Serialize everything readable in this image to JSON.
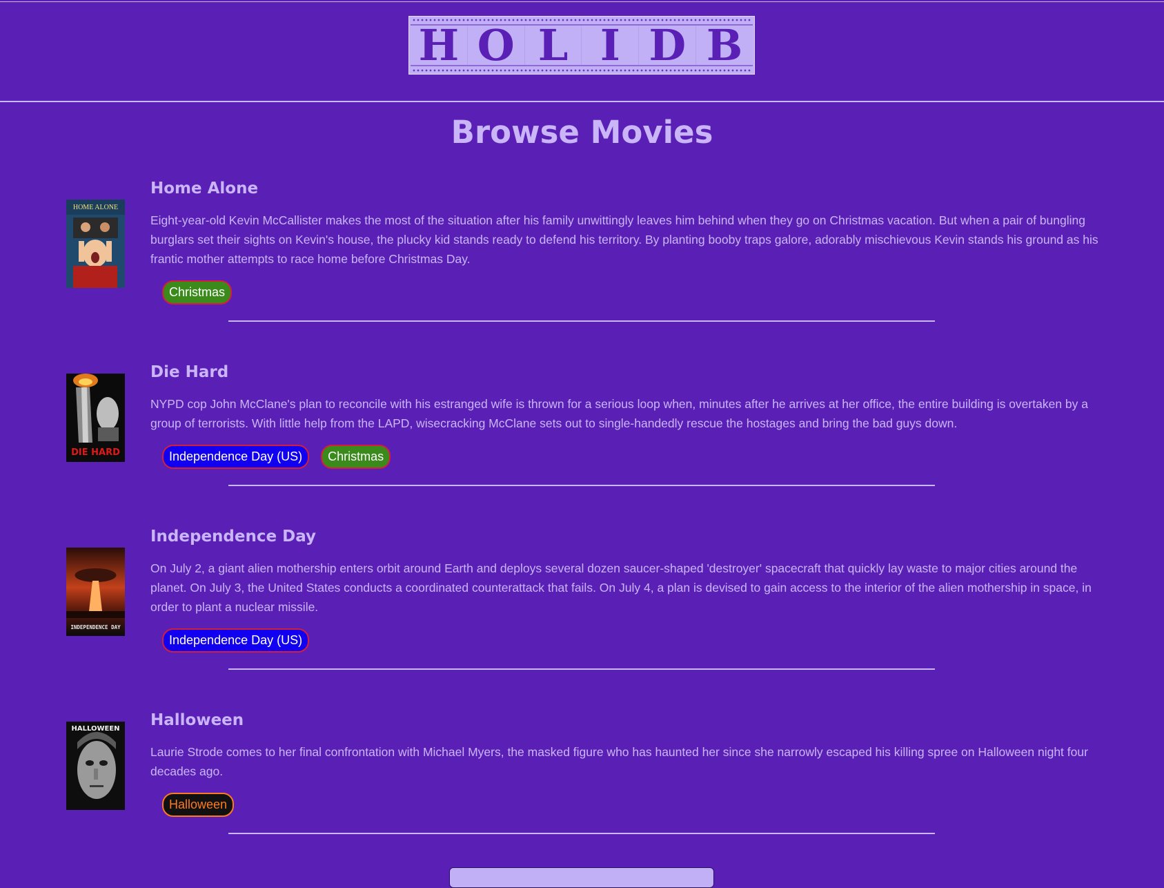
{
  "header": {
    "logo_letters": [
      "H",
      "O",
      "L",
      "I",
      "D",
      "B"
    ]
  },
  "page": {
    "title": "Browse Movies"
  },
  "movies": [
    {
      "title": "Home Alone",
      "description": "Eight-year-old Kevin McCallister makes the most of the situation after his family unwittingly leaves him behind when they go on Christmas vacation. But when a pair of bungling burglars set their sights on Kevin's house, the plucky kid stands ready to defend his territory. By planting booby traps galore, adorably mischievous Kevin stands his ground as his frantic mother attempts to race home before Christmas Day.",
      "poster_text": "HOME ALONE",
      "tags": [
        "Christmas"
      ]
    },
    {
      "title": "Die Hard",
      "description": "NYPD cop John McClane's plan to reconcile with his estranged wife is thrown for a serious loop when, minutes after he arrives at her office, the entire building is overtaken by a group of terrorists. With little help from the LAPD, wisecracking McClane sets out to single-handedly rescue the hostages and bring the bad guys down.",
      "poster_text": "DIE HARD",
      "tags": [
        "Independence Day (US)",
        "Christmas"
      ]
    },
    {
      "title": "Independence Day",
      "description": "On July 2, a giant alien mothership enters orbit around Earth and deploys several dozen saucer-shaped 'destroyer' spacecraft that quickly lay waste to major cities around the planet. On July 3, the United States conducts a coordinated counterattack that fails. On July 4, a plan is devised to gain access to the interior of the alien mothership in space, in order to plant a nuclear missile.",
      "poster_text": "INDEPENDENCE DAY",
      "tags": [
        "Independence Day (US)"
      ]
    },
    {
      "title": "Halloween",
      "description": "Laurie Strode comes to her final confrontation with Michael Myers, the masked figure who has haunted her since she narrowly escaped his killing spree on Halloween night four decades ago.",
      "poster_text": "HALLOWEEN",
      "tags": [
        "Halloween"
      ]
    }
  ],
  "colors": {
    "background": "#5a20b6",
    "text": "#c9b5f8",
    "tag_christmas": "#3a8a1c",
    "tag_independence": "#1200f0",
    "tag_halloween_text": "#ff7a1a"
  }
}
